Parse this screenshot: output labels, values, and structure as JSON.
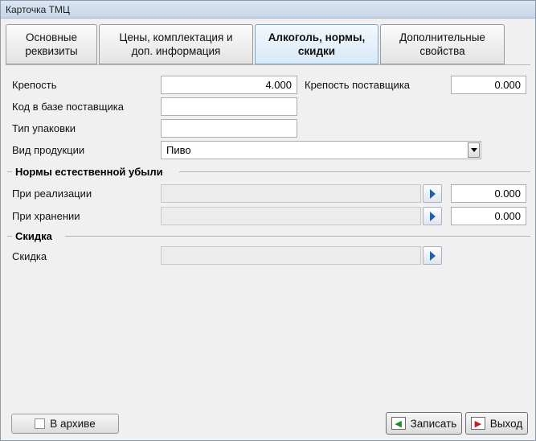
{
  "window": {
    "title": "Карточка ТМЦ"
  },
  "tabs": [
    {
      "label": "Основные\nреквизиты",
      "active": false
    },
    {
      "label": "Цены, комплектация и\nдоп.  информация",
      "active": false
    },
    {
      "label": "Алкоголь, нормы,\nскидки",
      "active": true
    },
    {
      "label": "Дополнительные\nсвойства",
      "active": false
    }
  ],
  "form": {
    "strength_label": "Крепость",
    "strength_value": "4.000",
    "supplier_strength_label": "Крепость поставщика",
    "supplier_strength_value": "0.000",
    "supplier_code_label": "Код в базе поставщика",
    "supplier_code_value": "",
    "package_type_label": "Тип упаковки",
    "package_type_value": "",
    "product_kind_label": "Вид продукции",
    "product_kind_value": "Пиво"
  },
  "losses": {
    "section_title": "Нормы естественной убыли",
    "sale_label": "При реализации",
    "sale_select_value": "",
    "sale_value": "0.000",
    "storage_label": "При хранении",
    "storage_select_value": "",
    "storage_value": "0.000"
  },
  "discount": {
    "section_title": "Скидка",
    "discount_label": "Скидка",
    "discount_value": ""
  },
  "footer": {
    "archive_label": "В архиве",
    "save_label": "Записать",
    "exit_label": "Выход"
  }
}
